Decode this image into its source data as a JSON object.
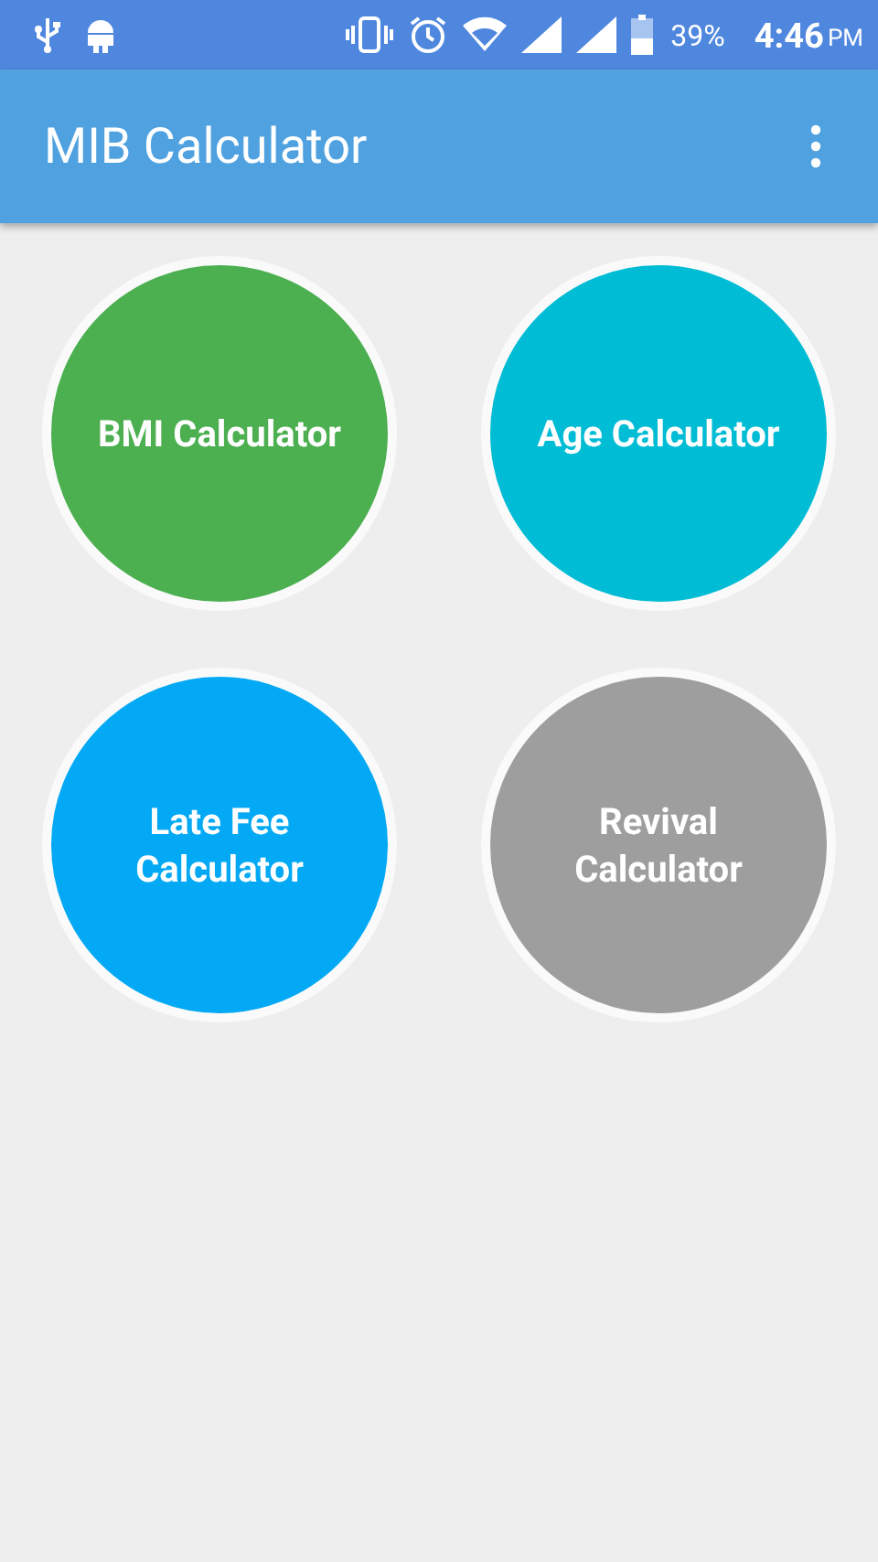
{
  "status_bar": {
    "battery": "39%",
    "time": "4:46",
    "period": "PM"
  },
  "app_bar": {
    "title": "MIB Calculator"
  },
  "calculators": [
    {
      "label": "BMI Calculator",
      "color": "#4caf50"
    },
    {
      "label": "Age Calculator",
      "color": "#00bcd4"
    },
    {
      "label": "Late Fee Calculator",
      "color": "#03a9f4"
    },
    {
      "label": "Revival Calculator",
      "color": "#9e9e9e"
    }
  ]
}
